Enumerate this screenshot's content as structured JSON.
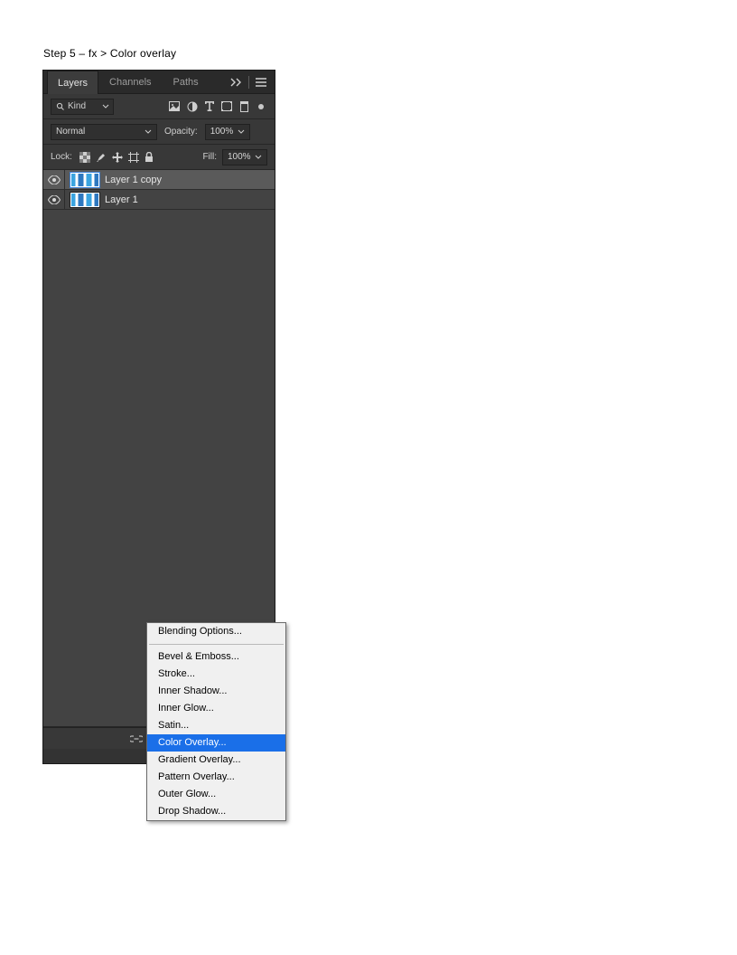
{
  "caption": "Step 5 – fx > Color overlay",
  "tabs": {
    "layers": "Layers",
    "channels": "Channels",
    "paths": "Paths"
  },
  "filter": {
    "kind_label": "Kind"
  },
  "blend": {
    "mode": "Normal",
    "opacity_label": "Opacity:",
    "opacity_value": "100%"
  },
  "lock": {
    "label": "Lock:",
    "fill_label": "Fill:",
    "fill_value": "100%"
  },
  "layers": [
    {
      "name": "Layer 1 copy",
      "selected": true
    },
    {
      "name": "Layer 1",
      "selected": false
    }
  ],
  "fx_menu": {
    "group1": [
      "Blending Options..."
    ],
    "group2": [
      "Bevel & Emboss...",
      "Stroke...",
      "Inner Shadow...",
      "Inner Glow...",
      "Satin...",
      "Color Overlay...",
      "Gradient Overlay...",
      "Pattern Overlay...",
      "Outer Glow...",
      "Drop Shadow..."
    ],
    "highlight": "Color Overlay..."
  }
}
